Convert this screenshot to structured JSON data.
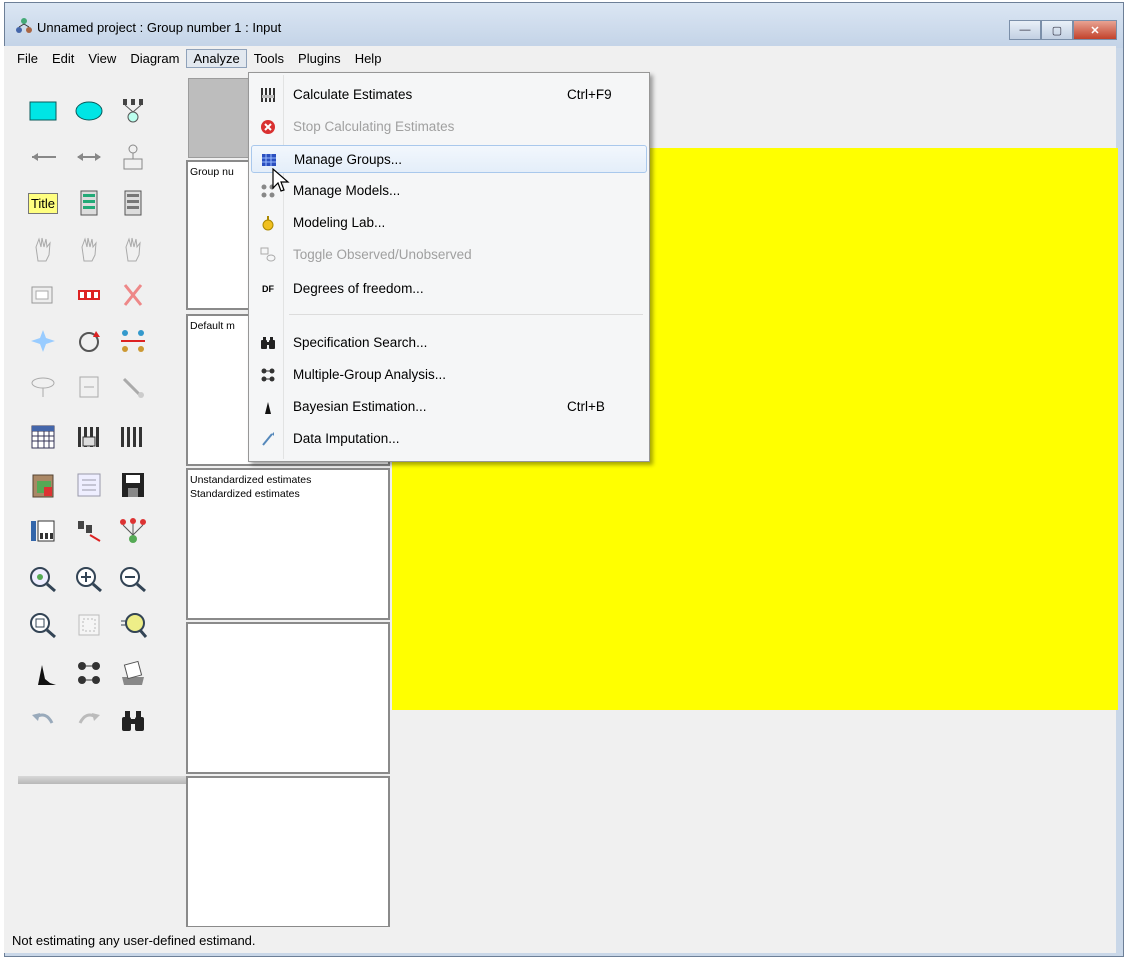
{
  "window": {
    "title": "Unnamed project : Group number 1 : Input",
    "minimize_symbol": "—",
    "maximize_symbol": "▢",
    "close_symbol": "✕"
  },
  "menubar": {
    "items": [
      {
        "label": "File"
      },
      {
        "label": "Edit"
      },
      {
        "label": "View"
      },
      {
        "label": "Diagram"
      },
      {
        "label": "Analyze",
        "active": true
      },
      {
        "label": "Tools"
      },
      {
        "label": "Plugins"
      },
      {
        "label": "Help"
      }
    ]
  },
  "toolbox": {
    "title_tool_label": "Title",
    "icons": [
      "rectangle-icon",
      "ellipse-icon",
      "indicator-icon",
      "single-arrow-icon",
      "double-arrow-icon",
      "unique-variable-icon",
      "title-icon",
      "list-variables-model-icon",
      "list-variables-data-icon",
      "select-one-icon",
      "select-all-icon",
      "deselect-all-icon",
      "duplicate-icon",
      "move-icon",
      "erase-icon",
      "shape-change-icon",
      "rotate-icon",
      "reflect-icon",
      "move-parameter-icon",
      "scroll-icon",
      "touch-up-icon",
      "data-files-icon",
      "analysis-properties-icon",
      "calculate-estimates-icon",
      "clipboard-icon",
      "text-output-icon",
      "save-icon",
      "object-properties-icon",
      "drag-properties-icon",
      "preserve-symmetries-icon",
      "zoom-select-icon",
      "zoom-in-icon",
      "zoom-out-icon",
      "zoom-page-icon",
      "fit-page-icon",
      "loupe-icon",
      "bayesian-icon",
      "multiple-group-icon",
      "print-icon",
      "undo-icon",
      "redo-icon",
      "specification-search-icon"
    ]
  },
  "panels": {
    "groups_label": "Group nu",
    "models_label": "Default m",
    "output_lines": [
      "Unstandardized estimates",
      "Standardized estimates"
    ]
  },
  "analyze_menu": {
    "items": [
      {
        "label": "Calculate Estimates",
        "shortcut": "Ctrl+F9",
        "icon": "calculate-estimates-icon",
        "disabled": false
      },
      {
        "label": "Stop Calculating Estimates",
        "shortcut": "",
        "icon": "stop-icon",
        "disabled": true
      },
      {
        "label": "Manage Groups...",
        "shortcut": "",
        "icon": "manage-groups-icon",
        "disabled": false,
        "hover": true
      },
      {
        "label": "Manage Models...",
        "shortcut": "",
        "icon": "manage-models-icon",
        "disabled": false
      },
      {
        "label": "Modeling Lab...",
        "shortcut": "",
        "icon": "modeling-lab-icon",
        "disabled": false
      },
      {
        "label": "Toggle Observed/Unobserved",
        "shortcut": "",
        "icon": "toggle-observed-icon",
        "disabled": true
      },
      {
        "label": "Degrees of freedom...",
        "shortcut": "",
        "icon": "df-icon",
        "icon_text": "DF",
        "disabled": false
      },
      {
        "label": "Specification Search...",
        "shortcut": "",
        "icon": "binoculars-icon",
        "disabled": false
      },
      {
        "label": "Multiple-Group Analysis...",
        "shortcut": "",
        "icon": "multiple-group-icon",
        "disabled": false
      },
      {
        "label": "Bayesian Estimation...",
        "shortcut": "Ctrl+B",
        "icon": "bayesian-icon",
        "disabled": false
      },
      {
        "label": "Data Imputation...",
        "shortcut": "",
        "icon": "data-imputation-icon",
        "disabled": false
      }
    ]
  },
  "statusbar": {
    "text": "Not estimating any user-defined estimand."
  },
  "colors": {
    "canvas_highlight": "#ffff00",
    "rectangle_tool": "#00e5e5",
    "menu_hover_border": "#a9c8ec"
  }
}
